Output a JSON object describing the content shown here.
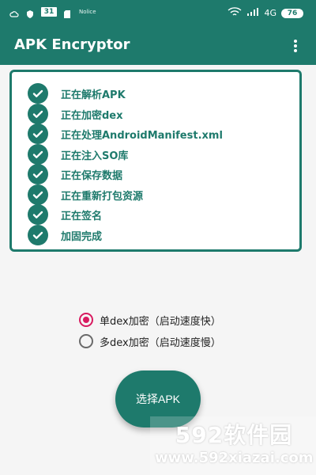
{
  "status_bar": {
    "network_label": "4G",
    "battery_text": "76",
    "calendar_day": "31",
    "note_text": "Nolice"
  },
  "app_bar": {
    "title": "APK Encryptor",
    "menu_icon": "more-vert-icon"
  },
  "steps": [
    {
      "label": "正在解析APK",
      "status": "done"
    },
    {
      "label": "正在加密dex",
      "status": "done"
    },
    {
      "label": "正在处理AndroidManifest.xml",
      "status": "done"
    },
    {
      "label": "正在注入SO库",
      "status": "done"
    },
    {
      "label": "正在保存数据",
      "status": "done"
    },
    {
      "label": "正在重新打包资源",
      "status": "done"
    },
    {
      "label": "正在签名",
      "status": "done"
    },
    {
      "label": "加固完成",
      "status": "done"
    }
  ],
  "options": [
    {
      "label": "单dex加密（启动速度快）",
      "selected": true
    },
    {
      "label": "多dex加密（启动速度慢）",
      "selected": false
    }
  ],
  "action": {
    "label": "选择APK"
  },
  "watermark": {
    "brand": "592软件园",
    "url": "www.592xiazai.com"
  },
  "colors": {
    "primary": "#1e7a6c",
    "accent": "#d81b60",
    "background": "#f5f5f5",
    "card_background": "#ffffff"
  }
}
